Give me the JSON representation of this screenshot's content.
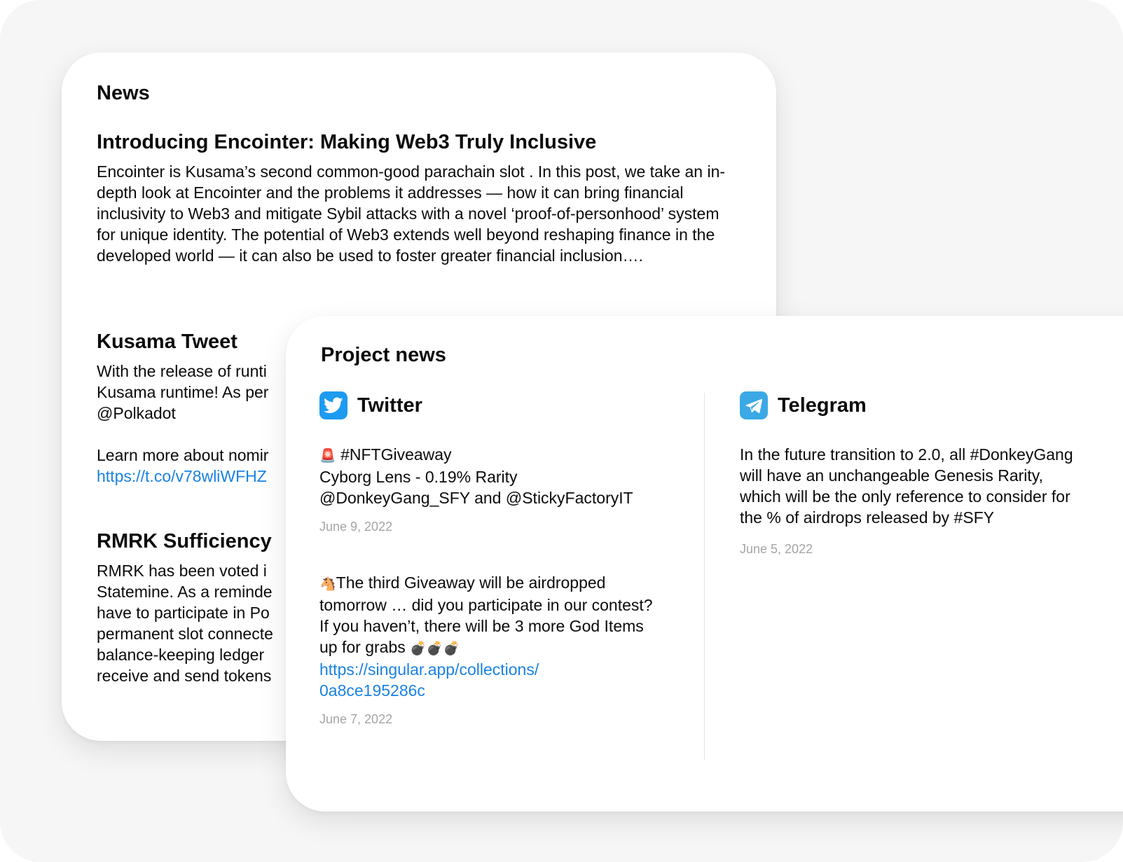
{
  "news": {
    "title": "News",
    "articles": [
      {
        "title": "Introducing Encointer: Making Web3 Truly Inclusive",
        "body": "Encointer is Kusama’s second common-good parachain slot . In this post, we take an in-depth look at Encointer and the problems it addresses — how it can bring financial inclusivity to Web3 and mitigate Sybil attacks with a novel ‘proof-of-personhood’ system for unique identity. The potential of Web3 extends well beyond reshaping finance in the developed world — it can also be used to foster greater financial inclusion…."
      },
      {
        "title": "Kusama Tweet",
        "line1": "With the release of runti",
        "line2": "Kusama runtime! As per",
        "line3": "@Polkadot",
        "line4": "Learn more about nomir",
        "link": "https://t.co/v78wliWFHZ"
      },
      {
        "title": "RMRK Sufficiency",
        "lines": [
          "RMRK has been voted i",
          "Statemine. As a reminde",
          "have to participate in Po",
          "permanent slot connecte",
          "balance-keeping ledger",
          "receive and send tokens"
        ]
      }
    ]
  },
  "project_news": {
    "title": "Project news",
    "twitter": {
      "label": "Twitter",
      "posts": [
        {
          "emoji": "🚨",
          "line1": "#NFTGiveaway",
          "line2": "Cyborg Lens - 0.19% Rarity",
          "line3": "@DonkeyGang_SFY and @StickyFactoryIT",
          "date": "June 9, 2022"
        },
        {
          "emoji": "🐴",
          "text": "The third Giveaway will be airdropped tomorrow … did you participate in our contest? If you haven’t, there will be 3 more God Items up for grabs",
          "trailing_emoji": "💣💣💣",
          "link_line1": "https://singular.app/collections/",
          "link_line2": "0a8ce195286c",
          "date": "June 7, 2022"
        }
      ]
    },
    "telegram": {
      "label": "Telegram",
      "posts": [
        {
          "text": "In the future transition to 2.0, all #DonkeyGang will have an unchangeable Genesis Rarity, which will be the only reference to consider for the % of airdrops released by #SFY",
          "date": "June 5, 2022"
        }
      ]
    }
  },
  "colors": {
    "link": "#1a82e2",
    "twitter": "#1d9bf0",
    "telegram": "#3aa9e6",
    "date": "#a4a4a4"
  }
}
